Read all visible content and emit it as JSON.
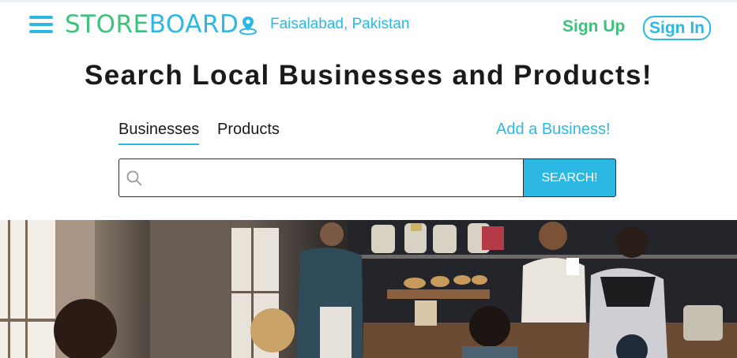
{
  "header": {
    "logo_part1": "STORE",
    "logo_part2": "BOARD",
    "location": "Faisalabad, Pakistan",
    "signup_label": "Sign Up",
    "signin_label": "Sign In"
  },
  "hero": {
    "title": "Search Local Businesses and Products!"
  },
  "tabs": [
    {
      "label": "Businesses",
      "active": true
    },
    {
      "label": "Products",
      "active": false
    }
  ],
  "add_business_label": "Add a Business!",
  "search": {
    "placeholder": "",
    "value": "",
    "button_label": "SEARCH!"
  },
  "colors": {
    "brand_green": "#3cc27a",
    "brand_blue": "#2db8e3"
  },
  "icons": {
    "menu": "hamburger-menu-icon",
    "location": "map-pin-icon",
    "search": "magnifier-icon"
  }
}
